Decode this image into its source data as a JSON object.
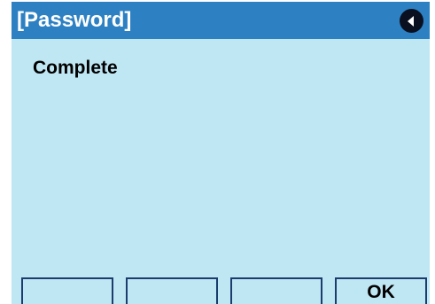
{
  "header": {
    "title": "[Password]",
    "back_icon": "back-arrow-icon"
  },
  "main": {
    "message": "Complete"
  },
  "softkeys": [
    {
      "label": ""
    },
    {
      "label": ""
    },
    {
      "label": ""
    },
    {
      "label": "OK"
    }
  ],
  "colors": {
    "title_bar": "#2d81c2",
    "screen_background": "#bfe6f3",
    "softkey_border": "#1a3d6e"
  }
}
